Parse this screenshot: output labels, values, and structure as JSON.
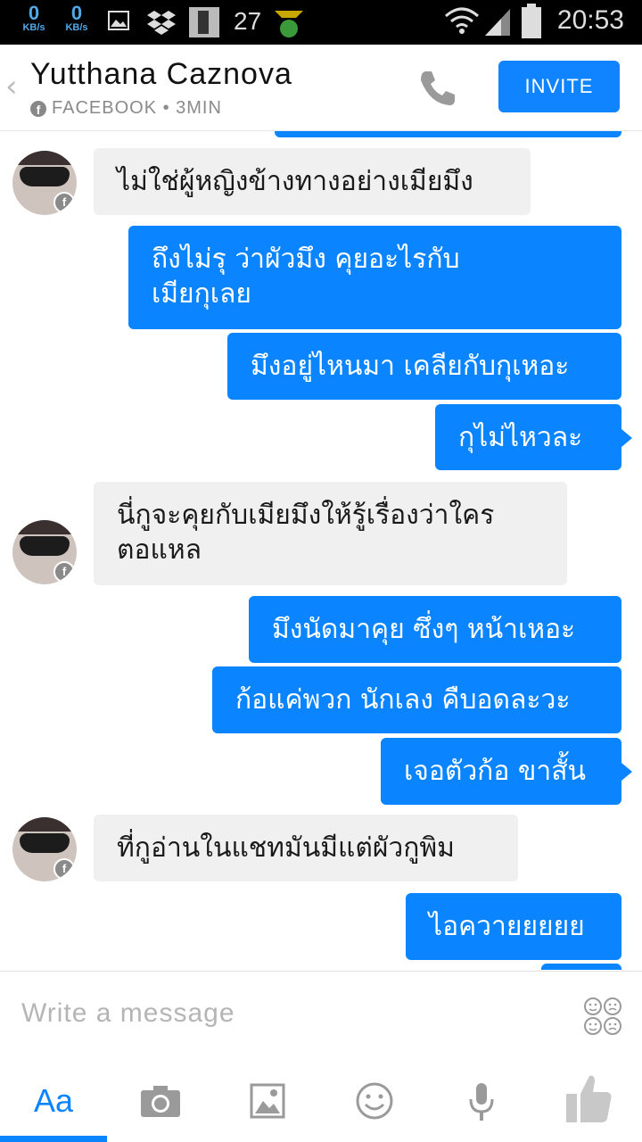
{
  "status_bar": {
    "net1_num": "0",
    "net1_unit": "KB/s",
    "net2_num": "0",
    "net2_unit": "KB/s",
    "notification_count": "27",
    "time": "20:53"
  },
  "header": {
    "contact_name": "Yutthana Caznova",
    "subtitle": "FACEBOOK • 3MIN",
    "invite_label": "INVITE"
  },
  "messages": [
    {
      "dir": "in",
      "text": "ไม่ใช่ผู้หญิงข้างทางอย่างเมียมึง"
    },
    {
      "dir": "out",
      "line1": "ถึงไม่รุ ว่าผัวมึง คุยอะไรกับ",
      "line2": "เมียกุเลย"
    },
    {
      "dir": "out",
      "text": "มึงอยู่ไหนมา เคลียกับกุเหอะ"
    },
    {
      "dir": "out",
      "text": "กุไม่ไหวละ"
    },
    {
      "dir": "in",
      "line1": "นี่กูจะคุยกับเมียมึงให้รู้เรื่องว่าใคร",
      "line2": "ตอแหล"
    },
    {
      "dir": "out",
      "text": "มึงนัดมาคุย ซึ่งๆ หน้าเหอะ"
    },
    {
      "dir": "out",
      "text": "ก้อแค่พวก นักเลง คืบอดละวะ"
    },
    {
      "dir": "out",
      "text": "เจอตัวก้อ ขาสั้น"
    },
    {
      "dir": "in",
      "text": "ที่กูอ่านในแชทมันมีแต่ผัวกูพิม"
    },
    {
      "dir": "out",
      "text": "ไอควายยยยย"
    }
  ],
  "composer": {
    "placeholder": "Write a message"
  },
  "toolbar": {
    "text_tab_label": "Aa"
  },
  "icons": {
    "back": "chevron-left-icon",
    "call": "phone-icon",
    "sticker": "sticker-icon",
    "camera": "camera-icon",
    "gallery": "image-icon",
    "emoji": "smiley-icon",
    "voice": "microphone-icon",
    "like": "thumbs-up-icon"
  },
  "colors": {
    "accent": "#0a84ff",
    "incoming_bubble": "#f1f0f0"
  }
}
